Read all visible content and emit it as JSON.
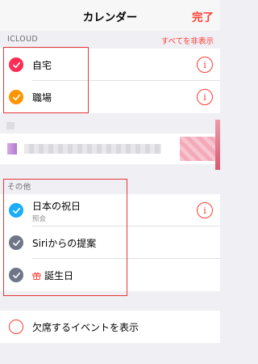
{
  "navbar": {
    "title": "カレンダー",
    "done_label": "完了"
  },
  "icloud": {
    "header": "ICLOUD",
    "hide_all_label": "すべてを非表示",
    "items": [
      {
        "label": "自宅",
        "checked": true,
        "color": "#ff2d55"
      },
      {
        "label": "職場",
        "checked": true,
        "color": "#ff9500"
      }
    ]
  },
  "other": {
    "header": "その他",
    "items": [
      {
        "label": "日本の祝日",
        "subtitle": "照会",
        "checked": true,
        "color": "#1badf8"
      },
      {
        "label": "Siriからの提案",
        "checked": true,
        "color": "#6e7687"
      },
      {
        "label": "誕生日",
        "checked": true,
        "color": "#6e7687",
        "icon": "gift-icon"
      }
    ]
  },
  "declined": {
    "label": "欠席するイベントを表示",
    "checked": false
  },
  "colors": {
    "accent": "#ff3b30",
    "annotation": "#e53935"
  }
}
